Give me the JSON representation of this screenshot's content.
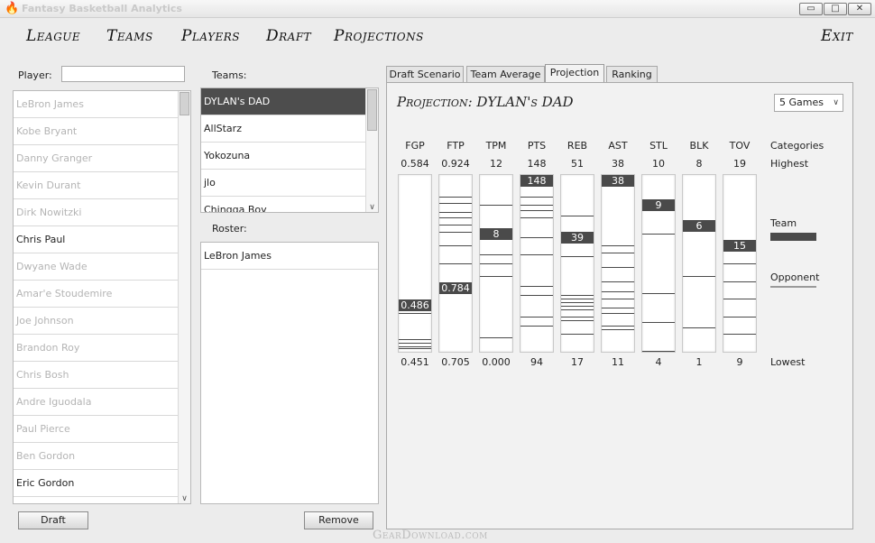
{
  "window": {
    "title": "Fantasy Basketball Analytics",
    "buttons": {
      "minimize": "▭",
      "maximize": "□",
      "close": "✕"
    }
  },
  "menu": [
    "League",
    "Teams",
    "Players",
    "Draft",
    "Projections",
    "Exit"
  ],
  "players": {
    "label": "Player:",
    "search_value": "",
    "items": [
      {
        "name": "LeBron James",
        "available": false
      },
      {
        "name": "Kobe Bryant",
        "available": false
      },
      {
        "name": "Danny Granger",
        "available": false
      },
      {
        "name": "Kevin Durant",
        "available": false
      },
      {
        "name": "Dirk Nowitzki",
        "available": false
      },
      {
        "name": "Chris Paul",
        "available": true
      },
      {
        "name": "Dwyane Wade",
        "available": false
      },
      {
        "name": "Amar'e Stoudemire",
        "available": false
      },
      {
        "name": "Joe Johnson",
        "available": false
      },
      {
        "name": "Brandon Roy",
        "available": false
      },
      {
        "name": "Chris Bosh",
        "available": false
      },
      {
        "name": "Andre Iguodala",
        "available": false
      },
      {
        "name": "Paul Pierce",
        "available": false
      },
      {
        "name": "Ben Gordon",
        "available": false
      },
      {
        "name": "Eric Gordon",
        "available": true
      }
    ],
    "draft_button": "Draft"
  },
  "teams": {
    "label": "Teams:",
    "items": [
      "DYLAN's DAD",
      "AllStarz",
      "Yokozuna",
      "jlo",
      "Chingga Boy"
    ],
    "selected_index": 0
  },
  "roster": {
    "label": "Roster:",
    "items": [
      "LeBron James"
    ],
    "remove_button": "Remove"
  },
  "tabs": [
    "Draft Scenario",
    "Team Average",
    "Projection",
    "Ranking"
  ],
  "active_tab": "Projection",
  "projection": {
    "title": "Projection: DYLAN's DAD",
    "games_select": "5 Games",
    "row_labels": {
      "categories": "Categories",
      "highest": "Highest",
      "lowest": "Lowest"
    },
    "legend": {
      "team": "Team",
      "opponent": "Opponent"
    }
  },
  "chart_data": {
    "type": "bar",
    "title": "Projection: DYLAN's DAD",
    "categories": [
      "FGP",
      "FTP",
      "TPM",
      "PTS",
      "REB",
      "AST",
      "STL",
      "BLK",
      "TOV"
    ],
    "highest": [
      "0.584",
      "0.924",
      "12",
      "148",
      "51",
      "38",
      "10",
      "8",
      "19"
    ],
    "lowest": [
      "0.451",
      "0.705",
      "0.000",
      "94",
      "17",
      "11",
      "4",
      "1",
      "9"
    ],
    "series": [
      {
        "name": "Team",
        "values": [
          "0.486",
          "0.784",
          "8",
          "148",
          "39",
          "38",
          "9",
          "6",
          "15"
        ]
      }
    ],
    "opponent_lines": [
      [
        0.75,
        0.78,
        0.93,
        0.95,
        0.97,
        0.98
      ],
      [
        0.12,
        0.16,
        0.21,
        0.24,
        0.28,
        0.32,
        0.4,
        0.5,
        0.62
      ],
      [
        0.17,
        0.3,
        0.45,
        0.5,
        0.57,
        0.92
      ],
      [
        0.12,
        0.17,
        0.2,
        0.24,
        0.35,
        0.45,
        0.63,
        0.68,
        0.8,
        0.85
      ],
      [
        0.23,
        0.46,
        0.68,
        0.7,
        0.72,
        0.74,
        0.76,
        0.8,
        0.82,
        0.9
      ],
      [
        0.4,
        0.44,
        0.52,
        0.6,
        0.66,
        0.7,
        0.75,
        0.78,
        0.85,
        0.87
      ],
      [
        0.33,
        0.67,
        0.83,
        1.0
      ],
      [
        0.29,
        0.57,
        0.86
      ],
      [
        0.5,
        0.6,
        0.7,
        0.8,
        0.9
      ]
    ]
  },
  "watermark": "GearDownload.com"
}
